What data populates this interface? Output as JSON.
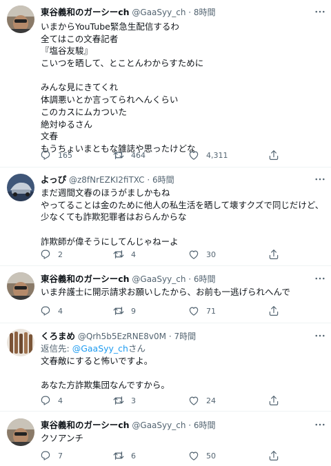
{
  "tweets": [
    {
      "name": "東谷義和のガーシーch",
      "handle": "@GaaSyy_ch",
      "time": "8時間",
      "lines": [
        "いまからYouTube緊急生配信するわ",
        "全てはこの文春記者",
        "『塩谷友駿』",
        "こいつを晒して、とことんわからすために",
        "",
        "みんな見にきてくれ",
        "体調悪いとか言ってられへんくらい",
        "このカスにムカついた",
        "絶対ゆるさん",
        "文春",
        "もうちょいまともな雑誌や思ったけどな"
      ],
      "replies": "165",
      "retweets": "464",
      "likes": "4,311"
    },
    {
      "name": "よっぴ",
      "handle": "@z8fNrEZKI2fiTXC",
      "time": "6時間",
      "lines": [
        "まだ週間文春のほうがましかもね",
        "やってることは金のために他人の私生活を晒して壊すクズで同じだけど、",
        "少なくても詐欺犯罪者はおらんからな",
        "",
        "詐欺師が偉そうにしてんじゃねーよ"
      ],
      "replies": "2",
      "retweets": "4",
      "likes": "30"
    },
    {
      "name": "東谷義和のガーシーch",
      "handle": "@GaaSyy_ch",
      "time": "6時間",
      "lines": [
        "いま弁護士に開示請求お願いしたから、お前も一逃げられへんで"
      ],
      "replies": "4",
      "retweets": "9",
      "likes": "71"
    },
    {
      "name": "くろまめ",
      "handle": "@Qrh5b5EzRNE8v0M",
      "time": "7時間",
      "reply_prefix": "返信先: ",
      "reply_mention": "@GaaSyy_ch",
      "reply_suffix": "さん",
      "lines": [
        "文春敵にすると怖いですよ。",
        "",
        "あなた方詐欺集団なんですから。"
      ],
      "replies": "4",
      "retweets": "3",
      "likes": "24"
    },
    {
      "name": "東谷義和のガーシーch",
      "handle": "@GaaSyy_ch",
      "time": "6時間",
      "lines": [
        "クソアンチ"
      ],
      "replies": "7",
      "retweets": "6",
      "likes": "50"
    }
  ],
  "separator": " · ",
  "colors": {
    "text": "#0f1419",
    "muted": "#536471",
    "link": "#1d9bf0",
    "divider": "#eff3f4"
  }
}
